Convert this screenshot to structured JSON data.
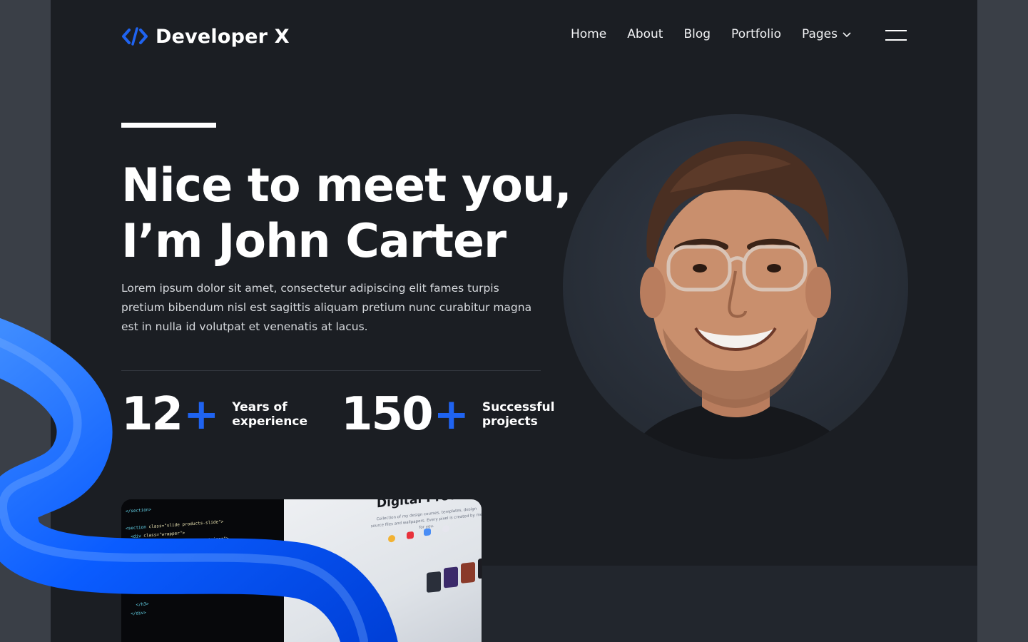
{
  "brand": {
    "name": "Developer X",
    "icon": "code-brackets-icon",
    "accent": "#1f63f0"
  },
  "nav": {
    "items": [
      {
        "label": "Home"
      },
      {
        "label": "About"
      },
      {
        "label": "Blog"
      },
      {
        "label": "Portfolio"
      },
      {
        "label": "Pages"
      }
    ],
    "menu_icon": "hamburger-menu-icon"
  },
  "hero": {
    "headline_line1": "Nice to meet you,",
    "headline_line2": "I’m John Carter",
    "intro": "Lorem ipsum dolor sit amet, consectetur adipiscing elit fames turpis pretium bibendum nisl est sagittis aliquam pretium nunc curabitur magna est in nulla id volutpat et venenatis at lacus."
  },
  "stats": [
    {
      "number": "12",
      "suffix": "+",
      "label_line1": "Years of",
      "label_line2": "experience"
    },
    {
      "number": "150",
      "suffix": "+",
      "label_line1": "Successful",
      "label_line2": "projects"
    }
  ],
  "showcase": {
    "title": "Digital Products",
    "subtitle": "Collection of my design courses, templates, design source files and wallpapers. Every pixel is created by me for you."
  },
  "colors": {
    "background": "#1b1e23",
    "outer": "#3a3f47",
    "accent": "#1f63f0"
  }
}
